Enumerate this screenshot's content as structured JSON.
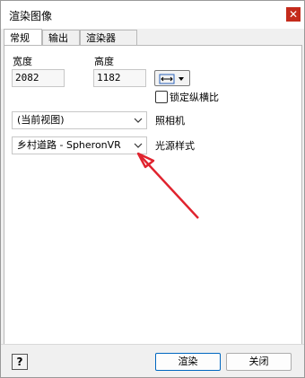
{
  "window": {
    "title": "渲染图像",
    "close_glyph": "✕"
  },
  "tabs": [
    {
      "label": "常规",
      "active": true
    },
    {
      "label": "输出",
      "active": false
    },
    {
      "label": "渲染器",
      "active": false
    }
  ],
  "general": {
    "width_label": "宽度",
    "width_value": "2082",
    "height_label": "高度",
    "height_value": "1182",
    "size_preset_icon": "horizontal-arrows-icon",
    "lock_aspect_label": "锁定纵横比",
    "lock_aspect_checked": false,
    "camera_select_value": "(当前视图)",
    "camera_label": "照相机",
    "lighting_select_value": "乡村道路 - SpheronVR",
    "lighting_label": "光源样式"
  },
  "footer": {
    "help_glyph": "?",
    "render_label": "渲染",
    "close_label": "关闭"
  },
  "annotation": {
    "color": "#e0232e"
  }
}
